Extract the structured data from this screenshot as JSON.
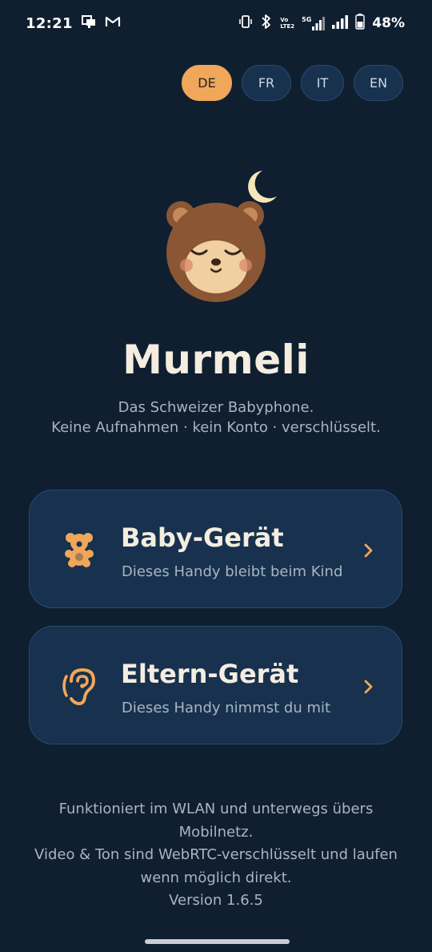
{
  "status_bar": {
    "time": "12:21",
    "volte_top": "Vo",
    "volte_bottom": "LTE2",
    "network": "5G",
    "battery": "48%"
  },
  "languages": [
    {
      "code": "DE",
      "active": true
    },
    {
      "code": "FR",
      "active": false
    },
    {
      "code": "IT",
      "active": false
    },
    {
      "code": "EN",
      "active": false
    }
  ],
  "app": {
    "title": "Murmeli",
    "tagline_line1": "Das Schweizer Babyphone.",
    "tagline_line2": "Keine Aufnahmen · kein Konto · verschlüsselt."
  },
  "cards": {
    "baby": {
      "title": "Baby-Gerät",
      "subtitle": "Dieses Handy bleibt beim Kind",
      "icon": "teddy-bear-icon"
    },
    "parent": {
      "title": "Eltern-Gerät",
      "subtitle": "Dieses Handy nimmst du mit",
      "icon": "ear-icon"
    }
  },
  "footer": {
    "line1": "Funktioniert im WLAN und unterwegs übers",
    "line2": "Mobilnetz.",
    "line3": "Video & Ton sind WebRTC-verschlüsselt und laufen",
    "line4": "wenn möglich direkt.",
    "version": "Version 1.6.5"
  },
  "colors": {
    "background": "#0f1f30",
    "card": "#17314e",
    "accent": "#f0a75a",
    "bear_fur": "#8a5634",
    "bear_muzzle": "#f0cfa0",
    "moon": "#f5e6b8"
  }
}
